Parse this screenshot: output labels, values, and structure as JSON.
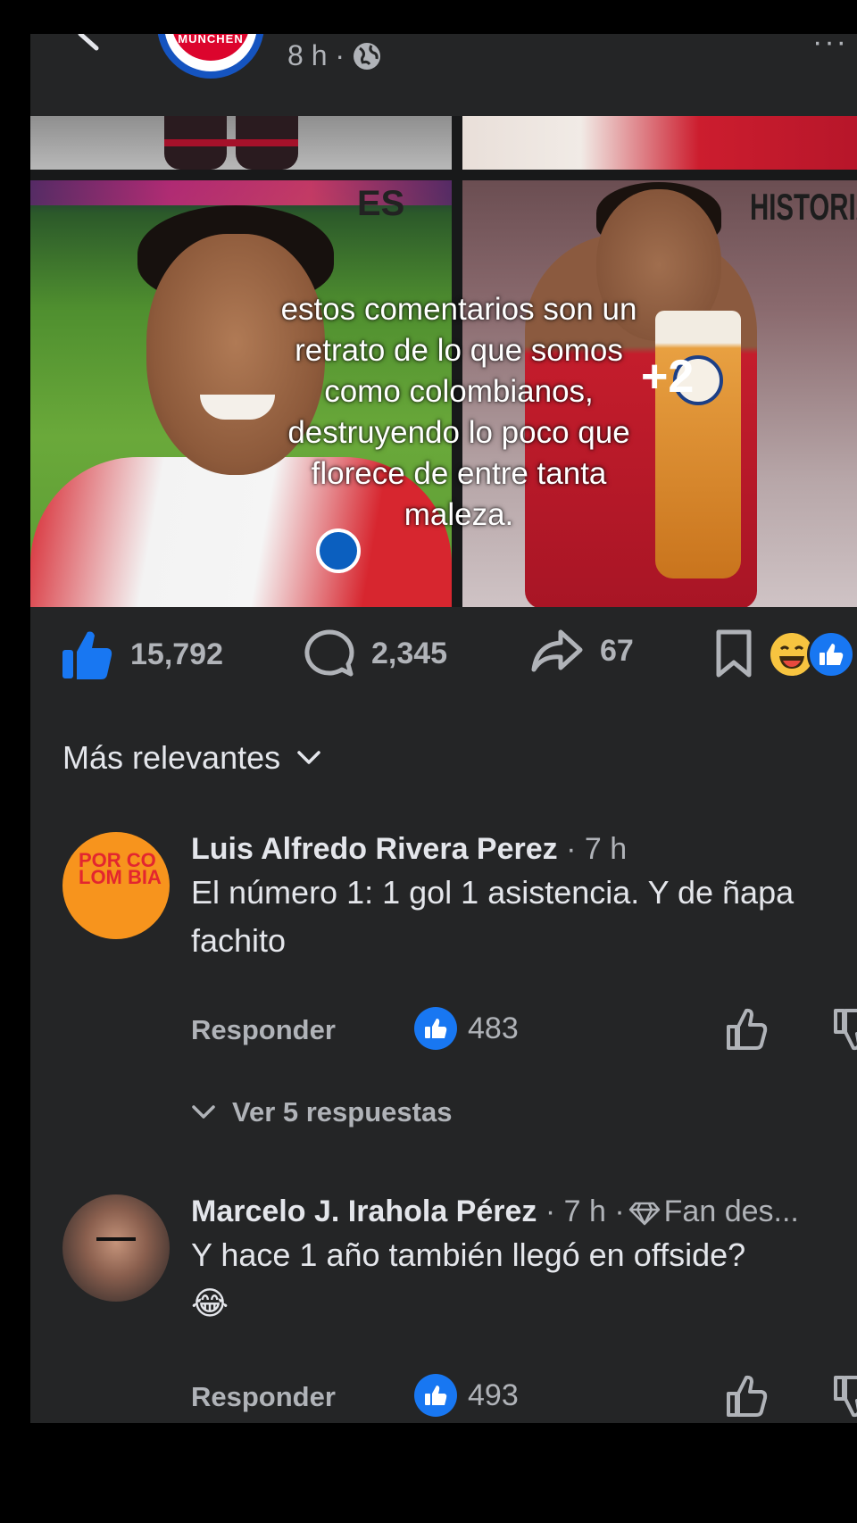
{
  "post": {
    "page_avatar_label": "MÜNCHEN",
    "time": "8 h ·",
    "more": "···",
    "overlay_caption": "estos comentarios son un retrato de lo que somos como colombianos, destruyendo lo poco que florece de entre tanta maleza.",
    "image_text_left": "ES",
    "image_text_right": "HISTORIA",
    "more_photos": "+2"
  },
  "actions": {
    "likes": "15,792",
    "comments": "2,345",
    "shares": "67"
  },
  "sort": {
    "label": "Más relevantes"
  },
  "comments": [
    {
      "avatar_text": "POR CO LOM BIA",
      "name": "Luis Alfredo Rivera Perez",
      "meta": " · 7 h",
      "text": "El número 1: 1 gol 1 asistencia. Y de ñapa fachito",
      "reply_label": "Responder",
      "likes": "483",
      "view_replies": "Ver 5 respuestas"
    },
    {
      "name": "Marcelo J. Irahola Pérez",
      "meta": " · 7 h ·",
      "badge": "Fan des...",
      "text": "Y hace 1 año también llegó en offside?",
      "emoji": "😂",
      "reply_label": "Responder",
      "likes": "493"
    }
  ],
  "colors": {
    "background": "#242526",
    "text_primary": "#e4e6eb",
    "text_secondary": "#b0b3b8",
    "accent_blue": "#1877f2"
  }
}
